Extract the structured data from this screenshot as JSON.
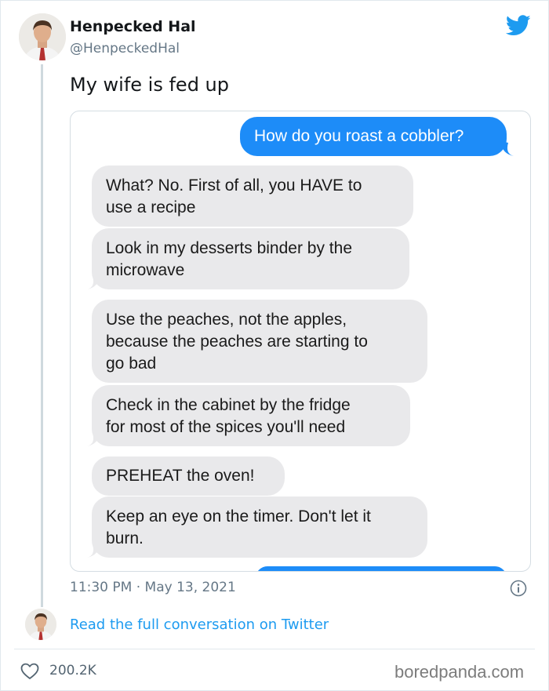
{
  "tweet": {
    "author_name": "Henpecked Hal",
    "author_handle": "@HenpeckedHal",
    "text": "My wife is fed up",
    "timestamp": "11:30 PM · May 13, 2021",
    "read_more": "Read the full conversation on Twitter",
    "likes": "200.2K"
  },
  "conversation": {
    "sent_1": "How do you roast a cobbler?",
    "reply_1_line1": "What? No. First of all, you HAVE to",
    "reply_1_line2": "use a recipe",
    "reply_2_line1": "Look in my desserts binder by the",
    "reply_2_line2": "microwave",
    "reply_3_line1": "Use the peaches, not the apples,",
    "reply_3_line2": "because the peaches are starting to",
    "reply_3_line3": "go bad",
    "reply_4_line1": "Check in the cabinet by the fridge",
    "reply_4_line2": "for most of the spices you'll need",
    "reply_5": "PREHEAT the oven!",
    "reply_6_line1": "Keep an eye on the timer. Don't let it",
    "reply_6_line2": "burn."
  },
  "icons": {
    "brand": "twitter-bird-icon",
    "info": "info-icon",
    "like": "heart-icon"
  },
  "colors": {
    "twitter_blue": "#1d9bf0",
    "imessage_blue": "#1d8cf8",
    "imessage_gray": "#e9e9eb"
  },
  "watermark": "boredpanda.com"
}
